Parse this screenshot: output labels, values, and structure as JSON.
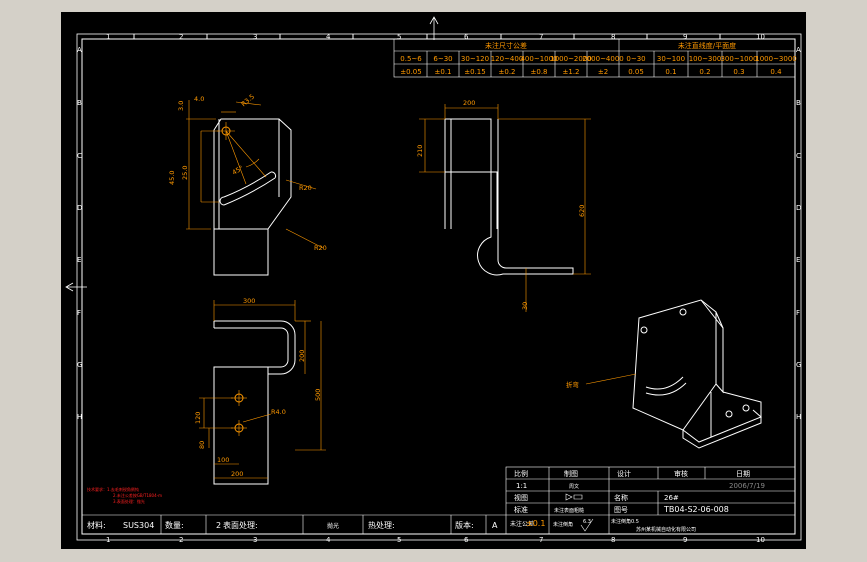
{
  "frame": {
    "col_markers": [
      "1",
      "2",
      "3",
      "4",
      "5",
      "6",
      "7",
      "8",
      "9",
      "10"
    ],
    "row_markers": [
      "A",
      "B",
      "C",
      "D",
      "E",
      "F",
      "G",
      "H"
    ]
  },
  "tolerance_table": {
    "linear_title": "未注尺寸公差",
    "flat_title": "未注直线度/平面度",
    "linear_ranges": [
      "0.5~6",
      "6~30",
      "30~120",
      "120~400",
      "400~1000",
      "1000~2000",
      "2000~4000"
    ],
    "linear_values": [
      "±0.05",
      "±0.1",
      "±0.15",
      "±0.2",
      "±0.8",
      "±1.2",
      "±2"
    ],
    "flat_ranges": [
      "0~30",
      "30~100",
      "100~300",
      "300~1000",
      "1000~3000"
    ],
    "flat_values": [
      "0.05",
      "0.1",
      "0.2",
      "0.3",
      "0.4"
    ]
  },
  "dimensions": {
    "d1": "4.0",
    "d2": "3.0",
    "d3": "R3.5",
    "d4": "45.0",
    "d5": "25.0",
    "d6": "45°",
    "d7": "R20",
    "d8": "R20",
    "d9": "200",
    "d10": "210",
    "d11": "620",
    "d12": "30",
    "d13": "300",
    "d14": "200",
    "d15": "500",
    "d16": "120",
    "d17": "80",
    "d18": "100",
    "d19": "200",
    "d20": "R4.0"
  },
  "iso": {
    "callout": "折弯"
  },
  "notes": [
    "技术要求：1.去毛刺锐角倒钝",
    "2.未注公差按GB/T1804-m",
    "3.表面处理：抛光"
  ],
  "title_block": {
    "headers": [
      "比例",
      "制图",
      "设计",
      "审核",
      "日期"
    ],
    "scale": "1:1",
    "drawer": "周文",
    "date": "2006/7/19",
    "view_label": "视图",
    "name_label": "名称",
    "name_value": "26#",
    "standard_label": "标准",
    "standard_value": "未注表面粗糙",
    "drawing_no_label": "图号",
    "drawing_no_value": "TB04-S2-06-008",
    "tol_label": "未注公差",
    "tol_value": "±0.1",
    "rough_label": "未注倒角",
    "rough_value": "6.3",
    "company": "苏州某机械自动化有限公司",
    "extra": "未注倒角0.5"
  },
  "bottom_bar": {
    "material_label": "材料:",
    "material_value": "SUS304",
    "qty_label": "数量:",
    "qty_value": "2",
    "surface_label": "表面处理:",
    "surface_value": "抛光",
    "heat_label": "热处理:",
    "version_label": "版本:",
    "version_value": "A"
  }
}
